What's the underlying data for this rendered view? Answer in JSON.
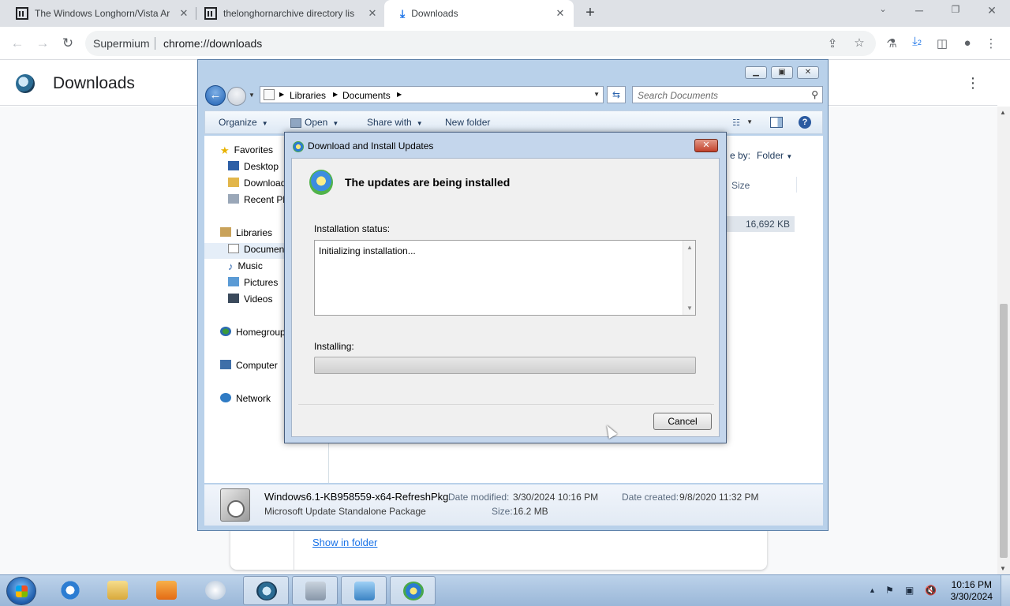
{
  "browser": {
    "tabs": [
      {
        "title": "The Windows Longhorn/Vista Ar",
        "active": false,
        "icon": "library-pillar-icon"
      },
      {
        "title": "thelonghornarchive directory lis",
        "active": false,
        "icon": "library-pillar-icon"
      },
      {
        "title": "Downloads",
        "active": true,
        "icon": "download-arrow-icon"
      }
    ],
    "omnibox": {
      "site": "Supermium",
      "url": "chrome://downloads"
    },
    "download_badge": "2"
  },
  "page": {
    "title": "Downloads",
    "show_in_folder": "Show in folder"
  },
  "explorer": {
    "breadcrumb": [
      "Libraries",
      "Documents"
    ],
    "search_placeholder": "Search Documents",
    "commands": {
      "organize": "Organize",
      "open": "Open",
      "share_with": "Share with",
      "new_folder": "New folder"
    },
    "arrange_by_label": "e by:",
    "arrange_by_value": "Folder",
    "column_size": "Size",
    "size_cell": "16,692 KB",
    "nav": {
      "favorites": "Favorites",
      "desktop": "Desktop",
      "downloads": "Download",
      "recent": "Recent Pl",
      "libraries": "Libraries",
      "documents": "Documen",
      "music": "Music",
      "pictures": "Pictures",
      "videos": "Videos",
      "homegroup": "Homegroup",
      "computer": "Computer",
      "network": "Network"
    },
    "details": {
      "name": "Windows6.1-KB958559-x64-RefreshPkg",
      "type": "Microsoft Update Standalone Package",
      "date_modified_label": "Date modified:",
      "date_modified": "3/30/2024 10:16 PM",
      "size_label": "Size:",
      "size": "16.2 MB",
      "date_created_label": "Date created:",
      "date_created": "9/8/2020 11:32 PM"
    }
  },
  "dialog": {
    "title": "Download and Install Updates",
    "heading": "The updates are being installed",
    "status_label": "Installation status:",
    "status_text": "Initializing installation...",
    "installing_label": "Installing:",
    "progress_fraction": 0.0,
    "cancel": "Cancel"
  },
  "taskbar": {
    "time": "10:16 PM",
    "date": "3/30/2024"
  }
}
